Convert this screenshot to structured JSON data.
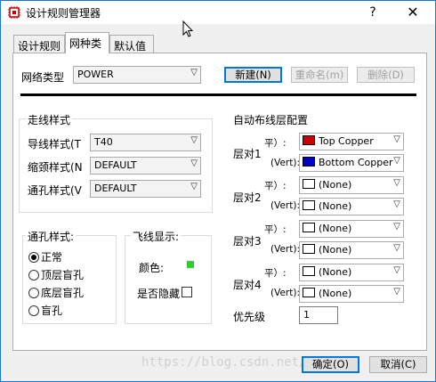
{
  "window": {
    "title": "设计规则管理器",
    "help": "?",
    "close": "✕"
  },
  "tabs": [
    {
      "label": "设计规则"
    },
    {
      "label": "网种类"
    },
    {
      "label": "默认值"
    }
  ],
  "net_type": {
    "label": "网络类型",
    "value": "POWER"
  },
  "buttons": {
    "new": "新建(N)",
    "rename": "重命名(m)",
    "delete": "删除(D)",
    "ok": "确定(O)",
    "cancel": "取消(C)"
  },
  "trace_style": {
    "title": "走线样式",
    "rows": [
      {
        "label": "导线样式(T",
        "value": "T40"
      },
      {
        "label": "缩颈样式(N",
        "value": "DEFAULT"
      },
      {
        "label": "通孔样式(V",
        "value": "DEFAULT"
      }
    ]
  },
  "via_style": {
    "title": "通孔样式:",
    "options": [
      "正常",
      "顶层盲孔",
      "底层盲孔",
      "盲孔"
    ],
    "selected": "正常"
  },
  "ratsnest": {
    "title": "飞线显示:",
    "color_label": "颜色:",
    "color": "#33cc33",
    "hide_label": "是否隐藏"
  },
  "routing": {
    "title": "自动布线层配置",
    "pairs": [
      {
        "label": "层对1",
        "h": "平）:",
        "v": "(Vert):",
        "h_layer": "Top Copper",
        "h_color": "#cc0000",
        "v_layer": "Bottom Copper",
        "v_color": "#0000cc"
      },
      {
        "label": "层对2",
        "h": "平）:",
        "v": "(Vert):",
        "h_layer": "(None)",
        "h_color": "#ffffff",
        "v_layer": "(None)",
        "v_color": "#ffffff"
      },
      {
        "label": "层对3",
        "h": "平）:",
        "v": "(Vert):",
        "h_layer": "(None)",
        "h_color": "#ffffff",
        "v_layer": "(None)",
        "v_color": "#ffffff"
      },
      {
        "label": "层对4",
        "h": "平）:",
        "v": "(Vert):",
        "h_layer": "(None)",
        "h_color": "#ffffff",
        "v_layer": "(None)",
        "v_color": "#ffffff"
      }
    ],
    "priority_label": "优先级",
    "priority_value": "1"
  },
  "watermark": "https://blog.csdn.net/..."
}
